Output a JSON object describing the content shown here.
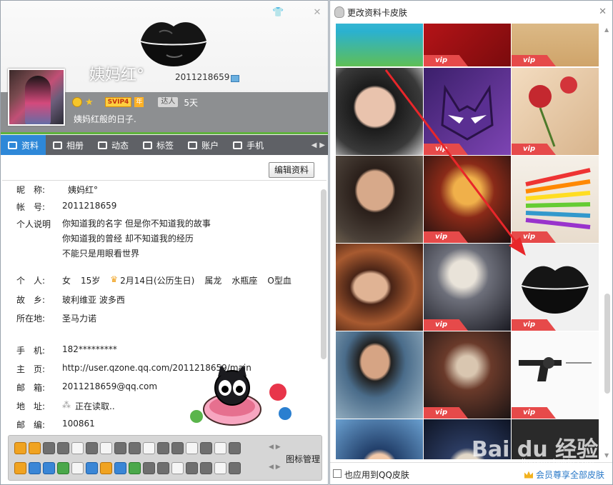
{
  "profile": {
    "nickname": "姨妈红°",
    "qq_number": "2011218659",
    "svip_label": "SVIP4",
    "svip_year": "年",
    "daren_label": "达人",
    "days": "5天",
    "signature": "姨妈红般的日子."
  },
  "tabs": [
    {
      "label": "资料",
      "icon": "profile-card-icon"
    },
    {
      "label": "相册",
      "icon": "album-icon"
    },
    {
      "label": "动态",
      "icon": "feed-icon"
    },
    {
      "label": "标签",
      "icon": "tag-icon"
    },
    {
      "label": "账户",
      "icon": "wallet-icon"
    },
    {
      "label": "手机",
      "icon": "phone-icon"
    }
  ],
  "edit_button": "编辑资料",
  "info": {
    "nick_label": "昵　称:",
    "nick_value": "姨妈红°",
    "acct_label": "帐　号:",
    "acct_value": "2011218659",
    "desc_label": "个人说明",
    "desc_lines": [
      "你知道我的名字 但是你不知道我的故事",
      "你知道我的曾经 却不知道我的经历",
      "不能只是用眼看世界"
    ],
    "person_label": "个　人:",
    "person_gender": "女",
    "person_age": "15岁",
    "person_birthday": "2月14日(公历生日)",
    "person_zodiac": "属龙",
    "person_sign": "水瓶座",
    "person_blood": "O型血",
    "hometown_label": "故　乡:",
    "hometown_value": "玻利维亚 波多西",
    "location_label": "所在地:",
    "location_value": "圣马力诺",
    "mobile_label": "手　机:",
    "mobile_value": "182*********",
    "homepage_label": "主　页:",
    "homepage_value": "http://user.qzone.qq.com/2011218659/main",
    "email_label": "邮　箱:",
    "email_value": "2011218659@qq.com",
    "address_label": "地　址:",
    "address_value": "正在读取..",
    "zip_label": "邮　编:",
    "zip_value": "100861"
  },
  "icons_manage": "图标管理",
  "skin_panel": {
    "title": "更改资料卡皮肤",
    "vip_tag": "vip",
    "apply_label": "也应用到QQ皮肤",
    "vip_all_label": "会员尊享全部皮肤"
  },
  "colors": {
    "tab_active": "#2e88d8",
    "vip_tag": "#e64a4a",
    "link": "#2878c8",
    "arrow": "#e8262a"
  }
}
